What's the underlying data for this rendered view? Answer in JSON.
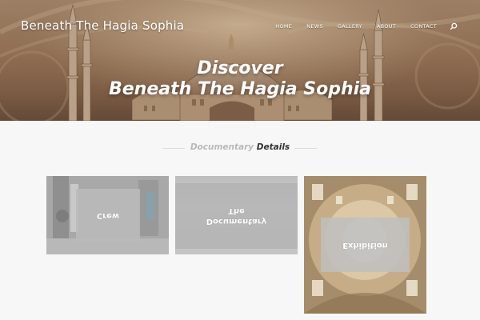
{
  "site": {
    "title": "Beneath The Hagia Sophia"
  },
  "nav": {
    "items": [
      "HOME",
      "NEWS",
      "GALLERY",
      "ABOUT",
      "CONTACT"
    ],
    "search_icon": "search-icon"
  },
  "hero": {
    "line1": "Discover",
    "line2": "Beneath The Hagia Sophia"
  },
  "section": {
    "title_muted": "Documentary",
    "title_strong": "Details"
  },
  "cards": [
    {
      "label": "Crew"
    },
    {
      "label_line1": "The",
      "label_line2": "Documentary"
    },
    {
      "label": "Exhibition"
    }
  ],
  "colors": {
    "background": "#f7f7f7",
    "title_text": "#333333",
    "muted_text": "#b9b9b9",
    "overlay": "#b9b9b9"
  }
}
